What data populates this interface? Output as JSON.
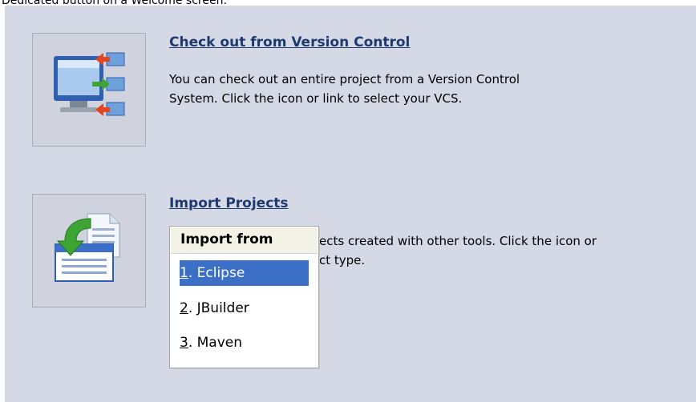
{
  "caption": "Dedicated button on a Welcome screen:",
  "vcs": {
    "link": "Check out from Version Control",
    "desc_line1": "You can check out an entire project from a Version Control",
    "desc_line2": "System. Click the icon or link to select your VCS.",
    "icon": "vcs-checkout-icon"
  },
  "import": {
    "link": "Import Projects",
    "desc_line1": "ects created with other tools. Click the icon or",
    "desc_line2": "ct type.",
    "icon": "import-project-icon"
  },
  "popup": {
    "header": "Import from",
    "items": [
      {
        "num": "1",
        "rest": ". Eclipse"
      },
      {
        "num": "2",
        "rest": ". JBuilder"
      },
      {
        "num": "3",
        "rest": ". Maven"
      }
    ],
    "selected_index": 0
  },
  "colors": {
    "panel": "#d5d9e6",
    "link": "#1f3a6e",
    "selection": "#3c6fc6"
  }
}
